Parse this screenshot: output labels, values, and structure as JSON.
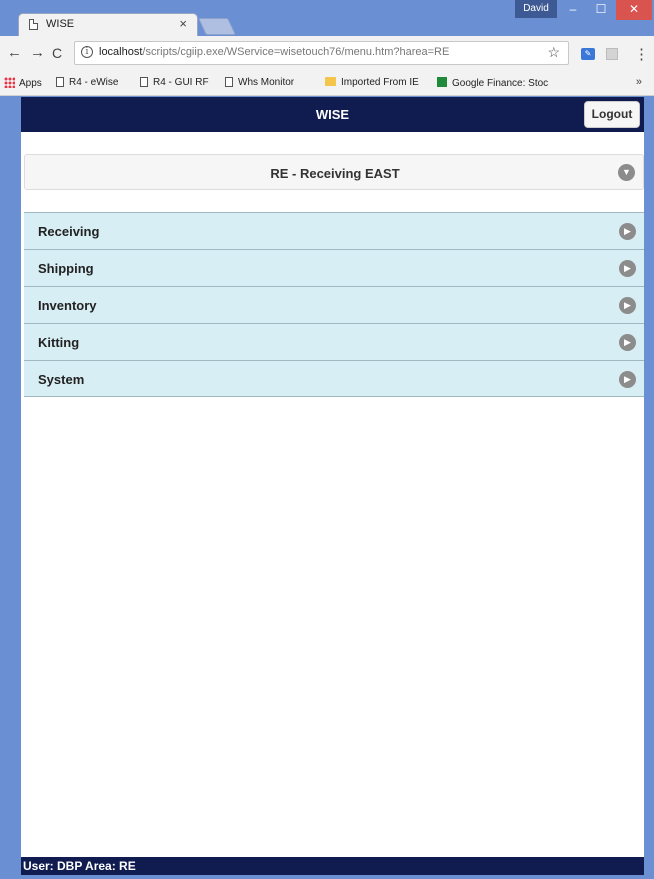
{
  "browser": {
    "tab_title": "WISE",
    "tab_close": "×",
    "profile_user": "David",
    "window_buttons": {
      "minimize": "–",
      "maximize": "☐",
      "close": "✕"
    },
    "nav": {
      "back": "←",
      "forward": "→",
      "reload": "C"
    },
    "url_host": "localhost",
    "url_path": "/scripts/cgiip.exe/WService=wisetouch76/menu.htm?harea=RE",
    "star": "☆",
    "ext1_label": "✎",
    "menu_dots": "⋮",
    "bookmarks": [
      {
        "label": "Apps",
        "icon": "apps-icon"
      },
      {
        "label": "R4 - eWise",
        "icon": "page-icon"
      },
      {
        "label": "R4 - GUI RF",
        "icon": "page-icon"
      },
      {
        "label": "Whs Monitor",
        "icon": "page-icon"
      },
      {
        "label": "Imported From IE",
        "icon": "folder-icon"
      },
      {
        "label": "Google Finance: Stoc",
        "icon": "google-finance-icon"
      }
    ],
    "bookmarks_more": "»"
  },
  "app": {
    "title": "WISE",
    "logout_label": "Logout",
    "area_label": "RE - Receiving EAST",
    "area_toggle_glyph": "▼",
    "menu_arrow_glyph": "▶",
    "menu_items": [
      {
        "label": "Receiving"
      },
      {
        "label": "Shipping"
      },
      {
        "label": "Inventory"
      },
      {
        "label": "Kitting"
      },
      {
        "label": "System"
      }
    ],
    "status": "User: DBP  Area: RE"
  },
  "colors": {
    "header_bg": "#101c50",
    "menu_item_bg": "#d8eef5",
    "window_frame": "#6a8fd2",
    "close_button": "#d9534f"
  }
}
